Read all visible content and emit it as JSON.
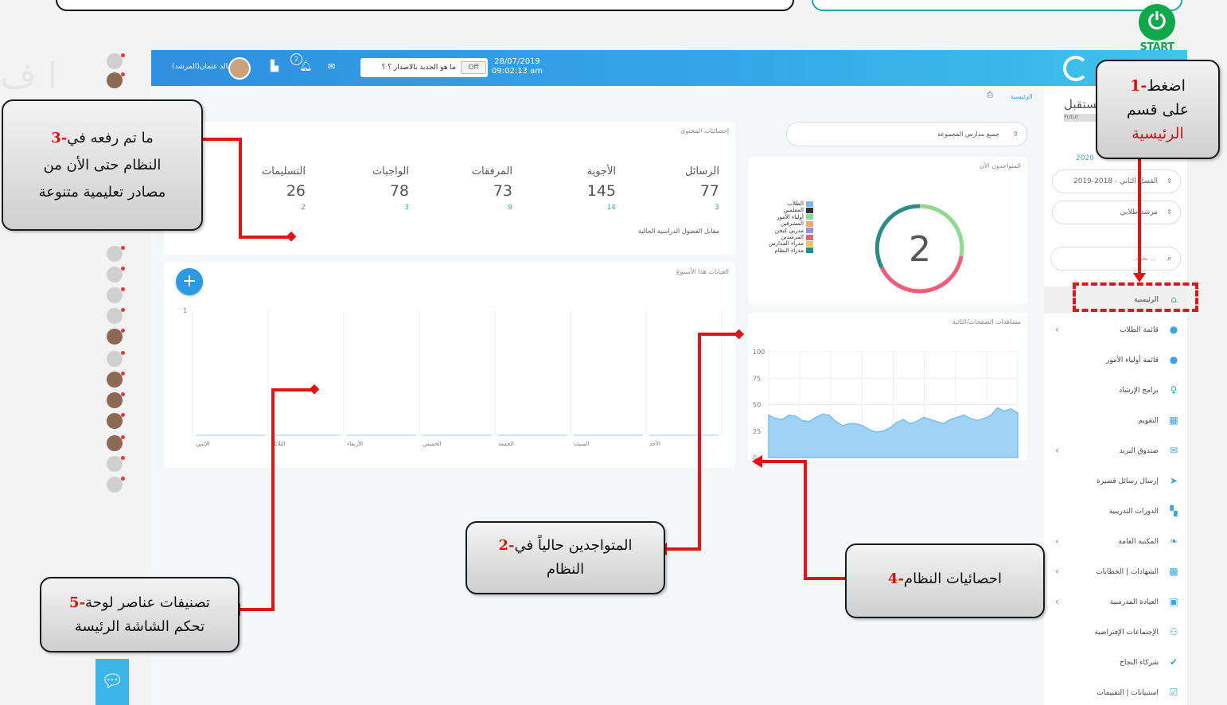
{
  "topbar": {
    "date": "28/07/2019",
    "time": "09:02:13 am",
    "toggle": "Off",
    "whats_new": "ما هو الجديد بالاصدار ؟ ؟",
    "user_name": "خالد عثمان(المرشد)",
    "notification_count": "2"
  },
  "breadcrumb": "الرئيسية",
  "sidebar": {
    "title": "مستقبل",
    "subtitle": "Futur",
    "year": "2020",
    "term_select": "الفصل الثاني - 2018-2019",
    "role_select": "مرشد طلابي",
    "search_placeholder": "بحث ...",
    "items": [
      {
        "label": "الرئيسية",
        "icon": "home-icon",
        "has_sub": false
      },
      {
        "label": "قائمة الطلاب",
        "icon": "user-icon",
        "has_sub": true
      },
      {
        "label": "قائمة أولياء الأمور",
        "icon": "user-icon",
        "has_sub": false
      },
      {
        "label": "برامج الإرشاد",
        "icon": "bulb-icon",
        "has_sub": false
      },
      {
        "label": "التقويم",
        "icon": "calendar-icon",
        "has_sub": false
      },
      {
        "label": "صندوق البريد",
        "icon": "mail-icon",
        "has_sub": true
      },
      {
        "label": "إرسال رسائل قصيرة",
        "icon": "send-icon",
        "has_sub": false
      },
      {
        "label": "الدورات التدريبية",
        "icon": "grid-icon",
        "has_sub": false
      },
      {
        "label": "المكتبة العامة",
        "icon": "leaf-icon",
        "has_sub": true
      },
      {
        "label": "الشهادات | الخطابات",
        "icon": "qr-icon",
        "has_sub": true
      },
      {
        "label": "العيادة المدرسية",
        "icon": "clinic-icon",
        "has_sub": true
      },
      {
        "label": "الإجتماعات الإفتراضية",
        "icon": "group-icon",
        "has_sub": false
      },
      {
        "label": "شركاء النجاح",
        "icon": "check-icon",
        "has_sub": false
      },
      {
        "label": "استبيانات | التقييمات",
        "icon": "survey-icon",
        "has_sub": false
      }
    ]
  },
  "content_stats": {
    "title": "إحصائيات المحتوى",
    "items": [
      {
        "label": "الرسائل",
        "value": "77",
        "count": "3"
      },
      {
        "label": "الأجوبة",
        "value": "145",
        "count": "14"
      },
      {
        "label": "المرفقات",
        "value": "73",
        "count": "9"
      },
      {
        "label": "الواجبات",
        "value": "78",
        "count": "3"
      },
      {
        "label": "التسليمات",
        "value": "26",
        "count": "2"
      }
    ],
    "note": "مقابل الفصول الدراسية الحالية"
  },
  "group_select": "جميع مدارس المجموعة",
  "online_now": {
    "title": "المتواجدون الآن",
    "value": "2",
    "legend": [
      {
        "label": "الطلاب",
        "color": "#7ab6f0"
      },
      {
        "label": "المعلمين",
        "color": "#333333"
      },
      {
        "label": "أولياء الأمور",
        "color": "#8fd88f"
      },
      {
        "label": "المشرفين",
        "color": "#f2a96a"
      },
      {
        "label": "مدربي كيجن",
        "color": "#9a8fe0"
      },
      {
        "label": "المرشدين",
        "color": "#ee5d7c"
      },
      {
        "label": "مدراء المدارس",
        "color": "#e8c65a"
      },
      {
        "label": "مدراء النظام",
        "color": "#2a8c82"
      }
    ]
  },
  "page_views": {
    "title": "مشاهدات الصفحات/الثانية"
  },
  "absences": {
    "title": "الغيابات هذا الأسبوع"
  },
  "callouts": {
    "c1_num": "1-",
    "c1_text_a": "اضغط",
    "c1_text_b": "على قسم",
    "c1_text_c": "الرئيسية",
    "c2_num": "2-",
    "c2_text_a": "المتواجدين حالياً في",
    "c2_text_b": "النظام",
    "c3_num": "3-",
    "c3_text_a": "ما تم رفعه في",
    "c3_text_b": "النظام حتى الأن من",
    "c3_text_c": "مصادر تعليمية متنوعة",
    "c4_num": "4-",
    "c4_text": "احصائيات النظام",
    "c5_num": "5-",
    "c5_text_a": "تصنيفات عناصر لوحة",
    "c5_text_b": "تحكم الشاشة الرئيسة"
  },
  "start_logo": {
    "text": "START"
  },
  "chart_data": [
    {
      "type": "area",
      "title": "مشاهدات الصفحات/الثانية",
      "ylim": [
        0,
        100
      ],
      "y_ticks": [
        "100",
        "75",
        "50",
        "25",
        "0"
      ],
      "values": [
        40,
        37,
        36,
        40,
        39,
        35,
        34,
        38,
        41,
        40,
        34,
        30,
        32,
        32,
        30,
        26,
        24,
        25,
        28,
        33,
        36,
        32,
        34,
        38,
        36,
        34,
        32,
        36,
        38,
        40,
        37,
        35,
        37,
        40,
        47,
        44,
        46,
        42
      ]
    },
    {
      "type": "bar",
      "title": "الغيابات هذا الأسبوع",
      "ylim": [
        0,
        1
      ],
      "y_ticks": [
        "1"
      ],
      "categories": [
        "الإثنين",
        "الثلاثاء",
        "الأربعاء",
        "الخميس",
        "الجمعة",
        "السبت",
        "الأحد"
      ],
      "values": [
        0,
        0,
        0,
        0,
        0,
        0,
        0
      ]
    }
  ]
}
